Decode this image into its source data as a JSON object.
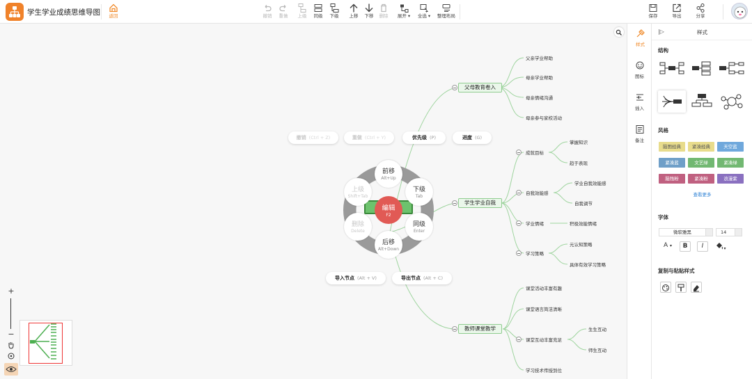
{
  "app": {
    "title": "学生学业成绩思维导图",
    "back_label": "返回"
  },
  "toolbar": {
    "undo": "撤销",
    "redo": "重做",
    "parent": "上级",
    "sibling": "同级",
    "child": "下级",
    "move_up": "上移",
    "move_down": "下移",
    "delete": "删除",
    "expand": "展开",
    "select_all": "全选",
    "arrange": "整理布局",
    "save": "保存",
    "export": "导出",
    "share": "分享"
  },
  "mindmap": {
    "branches": [
      {
        "label": "父母教育卷入",
        "children": [
          "父亲学业帮助",
          "母亲学业帮助",
          "母亲情绪沟通",
          "母亲参与家校活动"
        ]
      },
      {
        "label": "学生学业自我",
        "children": [
          {
            "label": "成就目标",
            "children": [
              "掌握知识",
              "趋于表现"
            ]
          },
          {
            "label": "自我效能感",
            "children": [
              "学业自我效能感",
              "自我调节"
            ]
          },
          {
            "label": "学业情绪",
            "children": [
              "积极效能情绪"
            ]
          },
          {
            "label": "学习策略",
            "children": [
              "元认知策略",
              "具体有效学习策略"
            ]
          }
        ]
      },
      {
        "label": "教师课堂教学",
        "children": [
          {
            "label": "课堂活动丰富有趣",
            "children": []
          },
          {
            "label": "课堂语言简洁清晰",
            "children": []
          },
          {
            "label": "课堂互动丰富充足",
            "children": [
              "生生互动",
              "师生互动"
            ]
          },
          {
            "label": "学习技术传授到位",
            "children": []
          }
        ]
      }
    ]
  },
  "radial_menu": {
    "center": {
      "label": "编辑",
      "key": "F2"
    },
    "move_prev": {
      "label": "前移",
      "key": "Alt+Up"
    },
    "child": {
      "label": "下级",
      "key": "Tab"
    },
    "sibling": {
      "label": "同级",
      "key": "Enter"
    },
    "move_next": {
      "label": "后移",
      "key": "Alt+Down"
    },
    "delete": {
      "label": "删除",
      "key": "Delete"
    },
    "parent": {
      "label": "上级",
      "key": "Shift+Tab"
    }
  },
  "context_pills": {
    "undo": {
      "label": "撤销",
      "key": "(Ctrl + Z)"
    },
    "redo": {
      "label": "重做",
      "key": "(Ctrl + Y)"
    },
    "priority": {
      "label": "优先级",
      "key": "(P)"
    },
    "progress": {
      "label": "进度",
      "key": "(G)"
    },
    "import_node": {
      "label": "导入节点",
      "key": "(Alt + V)"
    },
    "export_node": {
      "label": "导出节点",
      "key": "(Alt + C)"
    }
  },
  "side_tabs": [
    "样式",
    "图标",
    "插入",
    "备注"
  ],
  "panel": {
    "title": "样式",
    "structure_title": "结构",
    "style_title": "风格",
    "themes": [
      {
        "label": "脑图经典",
        "bg": "#e8dc8c",
        "fg": "#555"
      },
      {
        "label": "紧凑经典",
        "bg": "#e8dc8c",
        "fg": "#555"
      },
      {
        "label": "天空蓝",
        "bg": "#6fa8dc",
        "fg": "#fff"
      },
      {
        "label": "紧凑蓝",
        "bg": "#6f9fc8",
        "fg": "#fff"
      },
      {
        "label": "文艺绿",
        "bg": "#72b872",
        "fg": "#fff"
      },
      {
        "label": "紧凑绿",
        "bg": "#72b872",
        "fg": "#fff"
      },
      {
        "label": "脑残粉",
        "bg": "#c06080",
        "fg": "#fff"
      },
      {
        "label": "紧凑粉",
        "bg": "#c06080",
        "fg": "#fff"
      },
      {
        "label": "浪漫紫",
        "bg": "#8a70c0",
        "fg": "#fff"
      }
    ],
    "more_label": "查看更多",
    "font_title": "字体",
    "font_family": "微软雅黑",
    "font_size": "14",
    "copy_title": "复制与粘贴样式"
  },
  "colors": {
    "accent": "#f08a2a",
    "root": "#6dc26d",
    "center_button": "#e15a55",
    "branch_fill": "#eaf7ea",
    "link": "#2a7fd4"
  }
}
